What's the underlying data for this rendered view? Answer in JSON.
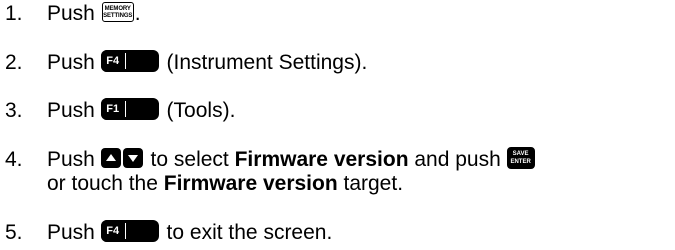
{
  "steps": [
    {
      "number": "1.",
      "push": "Push",
      "key_lines": [
        "MEMORY",
        "SETTINGS"
      ],
      "suffix": "."
    },
    {
      "number": "2.",
      "push": "Push",
      "key_label": "F4",
      "suffix": " (Instrument Settings)."
    },
    {
      "number": "3.",
      "push": "Push",
      "key_label": "F1",
      "suffix": " (Tools)."
    },
    {
      "number": "4.",
      "push": "Push",
      "key_icons": [
        "up-arrow",
        "down-arrow"
      ],
      "mid1": " to select ",
      "bold1": "Firmware version",
      "mid2": " and push ",
      "enter_key_lines": [
        "SAVE",
        "ENTER"
      ],
      "line2_pre": "or touch the ",
      "bold2": "Firmware version",
      "line2_post": " target."
    },
    {
      "number": "5.",
      "push": "Push",
      "key_label": "F4",
      "suffix": " to exit the screen."
    }
  ]
}
